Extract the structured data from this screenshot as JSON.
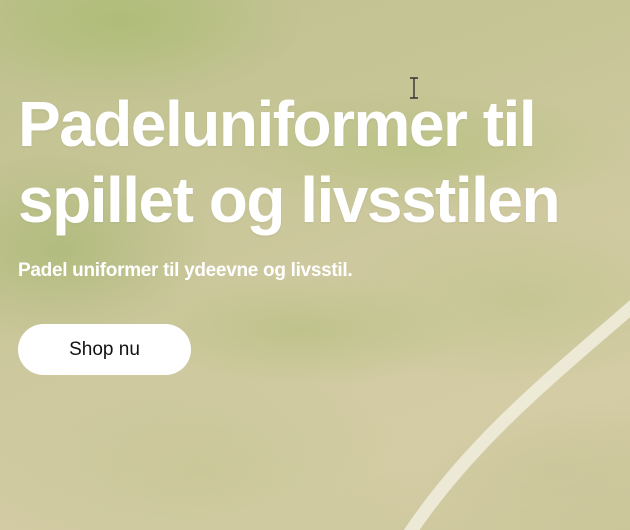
{
  "hero": {
    "headline_line1": "Padeluniformer til",
    "headline_line2": "spillet og livsstilen",
    "subheadline": "Padel uniformer til ydeevne og livsstil.",
    "cta_label": "Shop nu"
  },
  "colors": {
    "text": "#ffffff",
    "button_bg": "#ffffff",
    "button_text": "#111111",
    "background_base": "#c9c598",
    "court_line": "#f1eedf"
  },
  "icons": {
    "mouse_cursor": "text-cursor-icon"
  }
}
